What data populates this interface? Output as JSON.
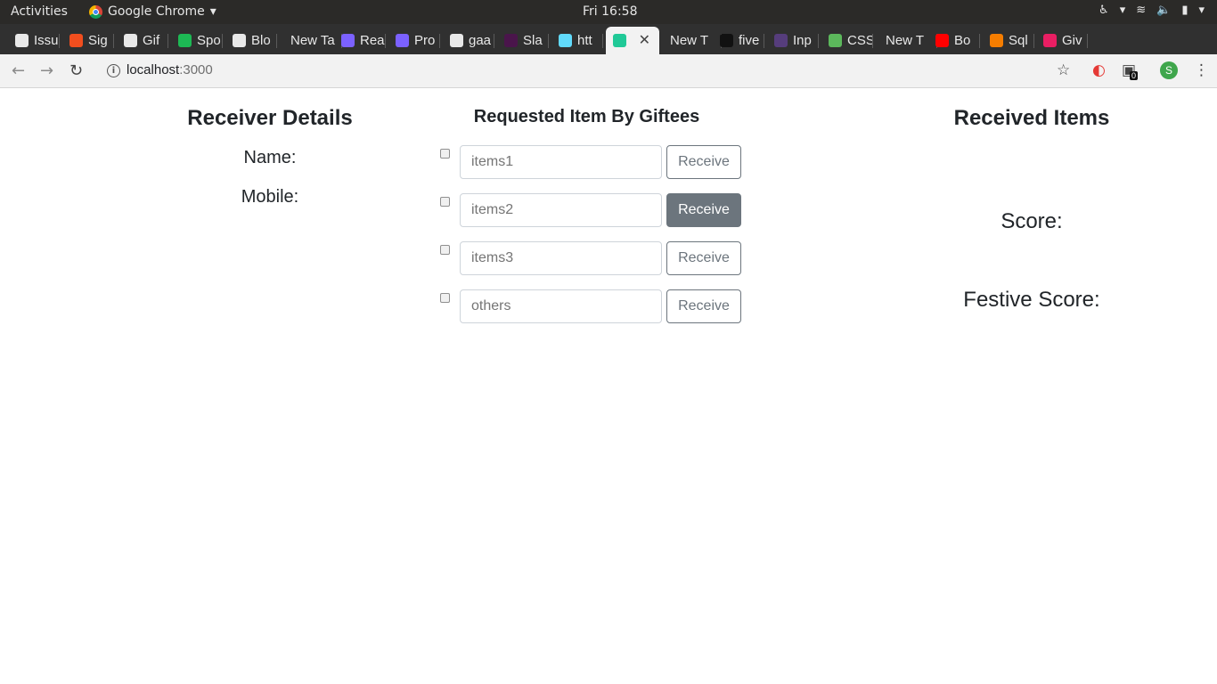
{
  "os": {
    "activities": "Activities",
    "app_name": "Google Chrome",
    "clock": "Fri 16:58"
  },
  "browser": {
    "tabs": [
      {
        "label": "Issu",
        "favicon_color": "#e8e8e8"
      },
      {
        "label": "Sig",
        "favicon_color": "#f24e1e"
      },
      {
        "label": "Gif",
        "favicon_color": "#e8e8e8"
      },
      {
        "label": "Spo",
        "favicon_color": "#1db954"
      },
      {
        "label": "Blo",
        "favicon_color": "#e8e8e8"
      },
      {
        "label": "New Ta",
        "favicon_color": ""
      },
      {
        "label": "Rea",
        "favicon_color": "#7b61ff"
      },
      {
        "label": "Pro",
        "favicon_color": "#7b61ff"
      },
      {
        "label": "gaa",
        "favicon_color": "#e8e8e8"
      },
      {
        "label": "Sla",
        "favicon_color": "#4a154b"
      },
      {
        "label": "htt",
        "favicon_color": "#61dafb"
      },
      {
        "label": "",
        "favicon_color": "#20c997",
        "active": true
      },
      {
        "label": "New T",
        "favicon_color": ""
      },
      {
        "label": "five",
        "favicon_color": "#111111"
      },
      {
        "label": "Inp",
        "favicon_color": "#563d7c"
      },
      {
        "label": "CSS",
        "favicon_color": "#5cb85c"
      },
      {
        "label": "New T",
        "favicon_color": ""
      },
      {
        "label": "Bo",
        "favicon_color": "#ff0000"
      },
      {
        "label": "Sql",
        "favicon_color": "#f57d00"
      },
      {
        "label": "Giv",
        "favicon_color": "#e91e63"
      }
    ],
    "url_host": "localhost",
    "url_port": ":3000",
    "profile_initial": "S",
    "extension_badge": "0"
  },
  "receiver": {
    "title": "Receiver Details",
    "name_label": "Name:",
    "mobile_label": "Mobile:"
  },
  "requested": {
    "title": "Requested Item By Giftees",
    "items": [
      {
        "placeholder": "items1",
        "button": "Receive",
        "checked": false
      },
      {
        "placeholder": "items2",
        "button": "Receive",
        "checked": false,
        "hovered": true
      },
      {
        "placeholder": "items3",
        "button": "Receive",
        "checked": false
      },
      {
        "placeholder": "others",
        "button": "Receive",
        "checked": false
      }
    ]
  },
  "received": {
    "title": "Received Items",
    "score_label": "Score:",
    "festive_label": "Festive Score:"
  }
}
